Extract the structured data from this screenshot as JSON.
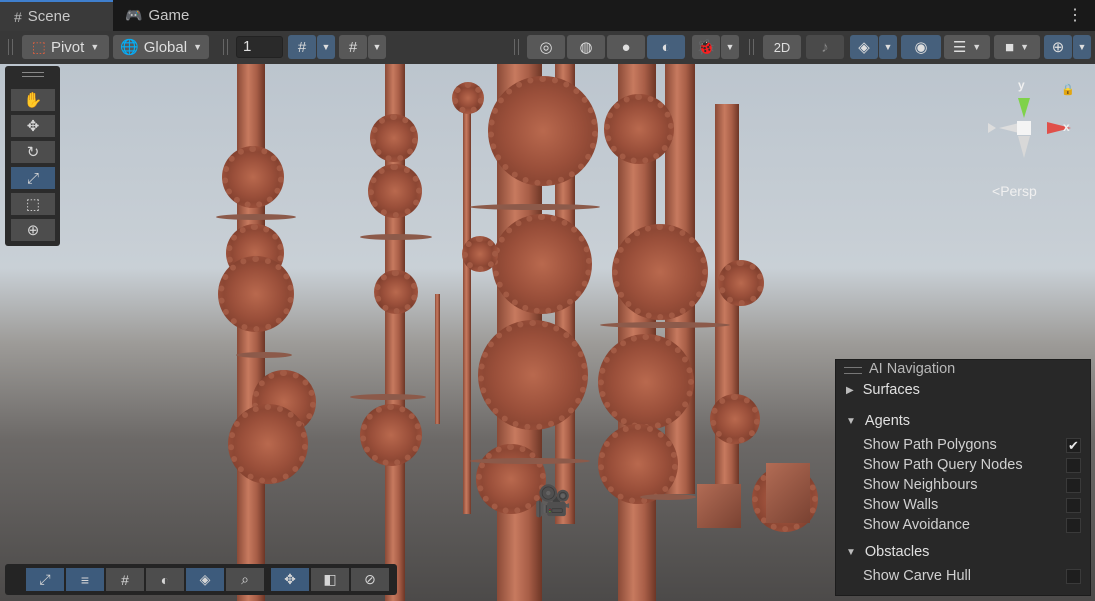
{
  "tabs": [
    {
      "label": "Scene",
      "icon": "grid-icon"
    },
    {
      "label": "Game",
      "icon": "gamepad-icon"
    }
  ],
  "toolbar": {
    "pivot_label": "Pivot",
    "global_label": "Global",
    "grid_increment": "1"
  },
  "viewport": {
    "persp_label": "Persp",
    "gizmo_y": "y",
    "gizmo_x": "x"
  },
  "ai_navigation": {
    "title": "AI Navigation",
    "sections": {
      "surfaces": "Surfaces",
      "agents": "Agents",
      "obstacles": "Obstacles"
    },
    "agent_options": [
      {
        "label": "Show Path Polygons",
        "checked": true
      },
      {
        "label": "Show Path Query Nodes",
        "checked": false
      },
      {
        "label": "Show Neighbours",
        "checked": false
      },
      {
        "label": "Show Walls",
        "checked": false
      },
      {
        "label": "Show Avoidance",
        "checked": false
      }
    ],
    "obstacle_options": [
      {
        "label": "Show Carve Hull",
        "checked": false
      }
    ]
  },
  "colors": {
    "accent": "#3f7fce",
    "toggle_on": "#46607c",
    "panel_bg": "#282828"
  }
}
